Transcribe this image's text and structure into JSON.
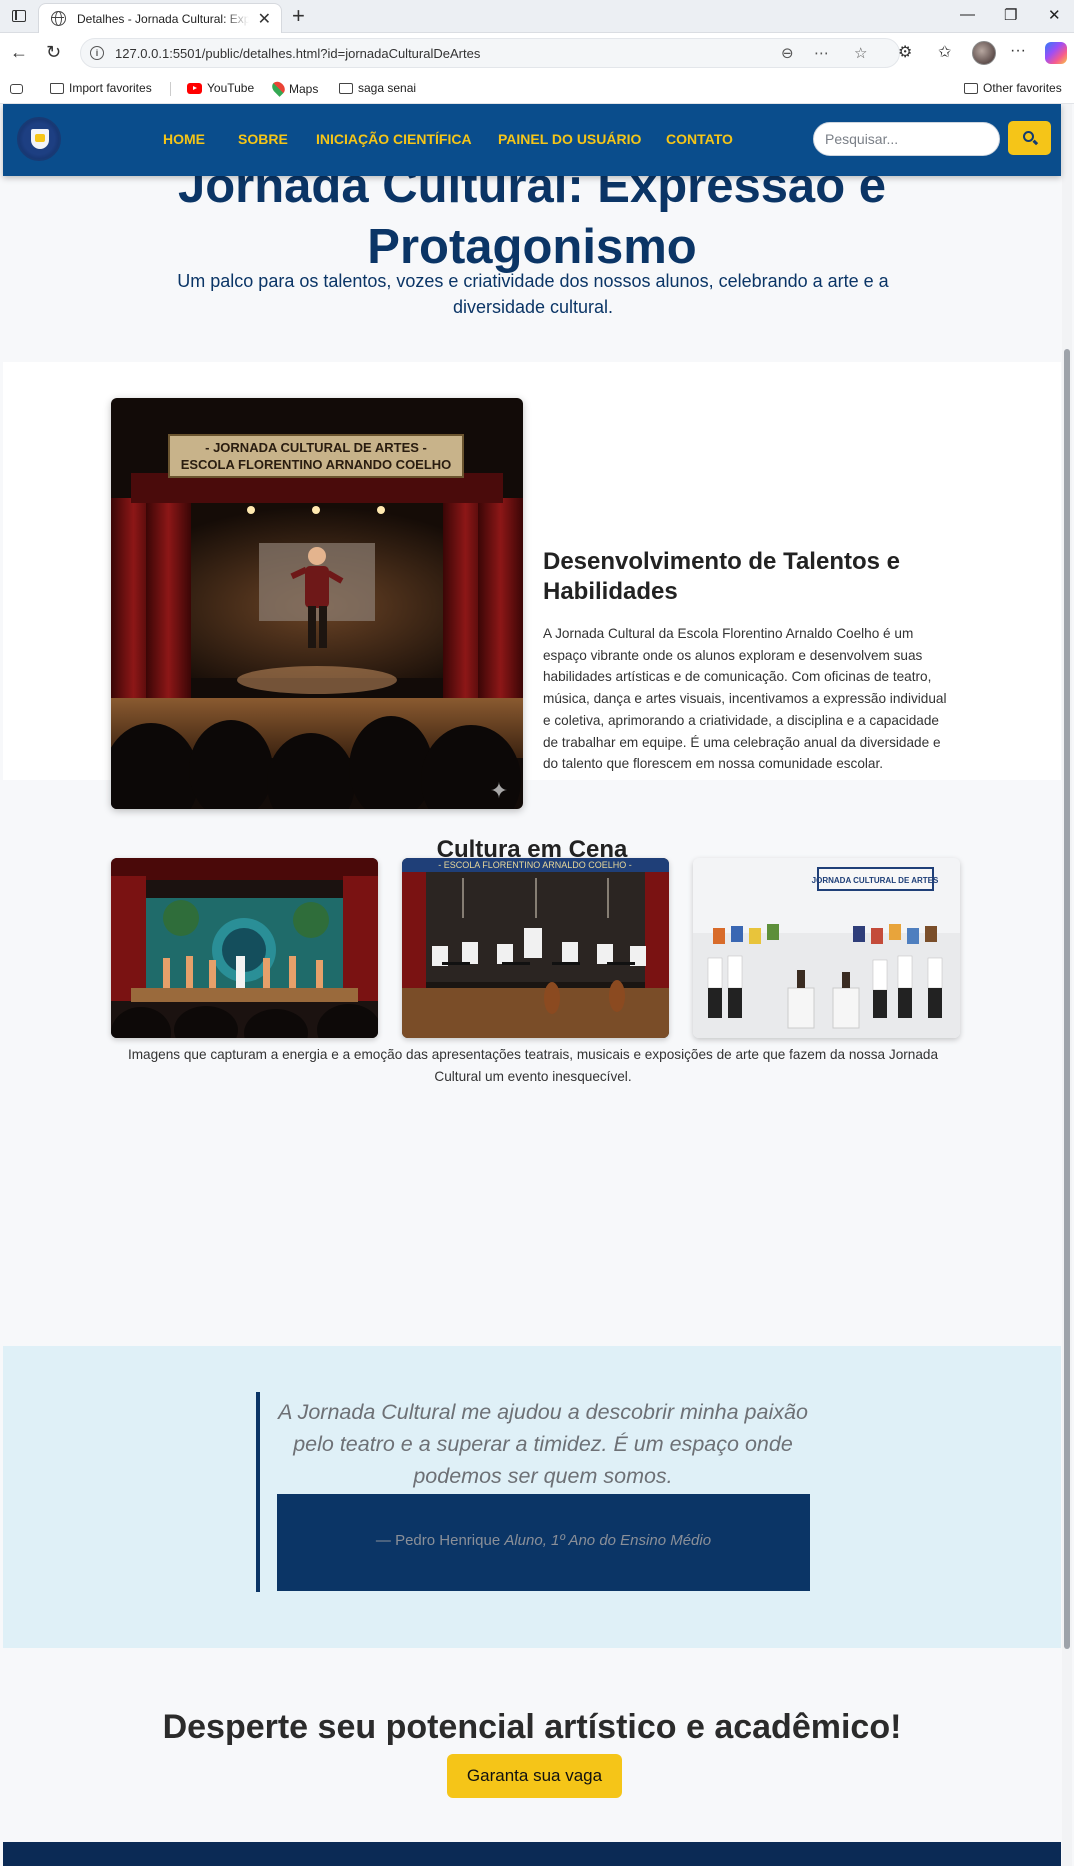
{
  "browser": {
    "tab_title": "Detalhes - Jornada Cultural: Expressão e Protagonismo",
    "url": "127.0.0.1:5501/public/detalhes.html?id=jornadaCulturalDeArtes",
    "bookmarks": [
      "Import favorites",
      "YouTube",
      "Maps",
      "saga senai"
    ],
    "other_favorites": "Other favorites"
  },
  "header": {
    "nav": [
      "HOME",
      "SOBRE",
      "INICIAÇÃO CIENTÍFICA",
      "PAINEL DO USUÁRIO",
      "CONTATO"
    ],
    "search_placeholder": "Pesquisar..."
  },
  "hero": {
    "title_line1": "Jornada Cultural: Expressão e",
    "title_line2": "Protagonismo",
    "subtitle": "Um palco para os talentos, vozes e criatividade dos nossos alunos, celebrando a arte e a diversidade cultural."
  },
  "feature": {
    "banner_line1": "- JORNADA CULTURAL DE ARTES -",
    "banner_line2": "ESCOLA FLORENTINO ARNANDO COELHO",
    "title": "Desenvolvimento de Talentos e Habilidades",
    "text": "A Jornada Cultural da Escola Florentino Arnaldo Coelho é um espaço vibrante onde os alunos exploram e desenvolvem suas habilidades artísticas e de comunicação. Com oficinas de teatro, música, dança e artes visuais, incentivamos a expressão individual e coletiva, aprimorando a criatividade, a disciplina e a capacidade de trabalhar em equipe. É uma celebração anual da diversidade e do talento que florescem em nossa comunidade escolar."
  },
  "gallery": {
    "title": "Cultura em Cena",
    "caption": "Imagens que capturam a energia e a emoção das apresentações teatrais, musicais e exposições de arte que fazem da nossa Jornada Cultural um evento inesquecível.",
    "orchestra_banner": "- ESCOLA FLORENTINO ARNALDO COELHO -",
    "expo_banner": "JORNADA CULTURAL DE ARTES"
  },
  "quote": {
    "text": "A Jornada Cultural me ajudou a descobrir minha paixão pelo teatro e a superar a timidez. É um espaço onde podemos ser quem somos.",
    "author": "— Pedro Henrique",
    "role": "Aluno, 1º Ano do Ensino Médio"
  },
  "cta": {
    "title": "Desperte seu potencial artístico e acadêmico!",
    "button": "Garanta sua vaga"
  },
  "colors": {
    "primary": "#0a4d8c",
    "dark_blue": "#0b3566",
    "accent": "#f5c518",
    "quote_bg": "#dff0f7"
  }
}
